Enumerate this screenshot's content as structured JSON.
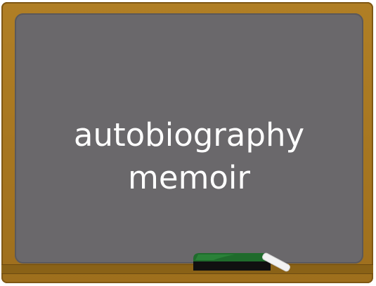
{
  "chalkboard": {
    "words": [
      "autobiography",
      "memoir"
    ],
    "colors": {
      "frame": "#9e6f1d",
      "board": "#6a686b",
      "text": "#ffffff",
      "eraser_top": "#1f6b2c",
      "eraser_base": "#101010",
      "chalk": "#f2f2f2"
    }
  }
}
